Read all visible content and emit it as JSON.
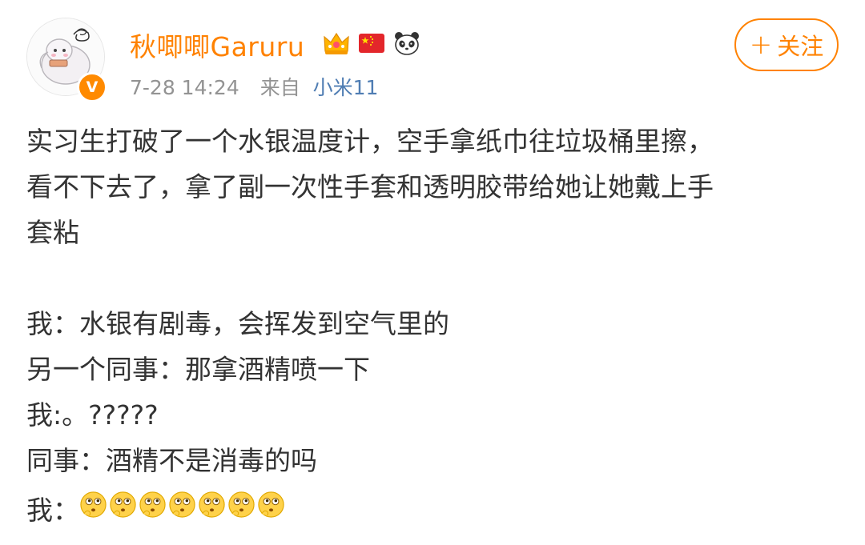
{
  "post": {
    "author": {
      "name": "秋唧唧Garuru",
      "verified_badge": "V",
      "badges": [
        "crown-icon",
        "china-flag-icon",
        "panda-icon"
      ]
    },
    "time": "7-28 14:24",
    "source_prefix": "来自",
    "source_device": "小米11",
    "follow": {
      "plus": "+",
      "label": "关注"
    },
    "text_lines": [
      "实习生打破了一个水银温度计，空手拿纸巾往垃圾桶里擦，",
      "看不下去了，拿了副一次性手套和透明胶带给她让她戴上手",
      "套粘",
      "",
      "我：水银有剧毒，会挥发到空气里的",
      "另一个同事：那拿酒精喷一下",
      "我:。?????",
      "同事：酒精不是消毒的吗",
      ""
    ],
    "last_line_prefix": "我：",
    "emoji_name": "pondering-face-emoji",
    "emoji_count": 7
  },
  "colors": {
    "accent": "#ff8200",
    "meta_gray": "#939393",
    "link_blue": "#4f7db3",
    "text": "#333333"
  }
}
